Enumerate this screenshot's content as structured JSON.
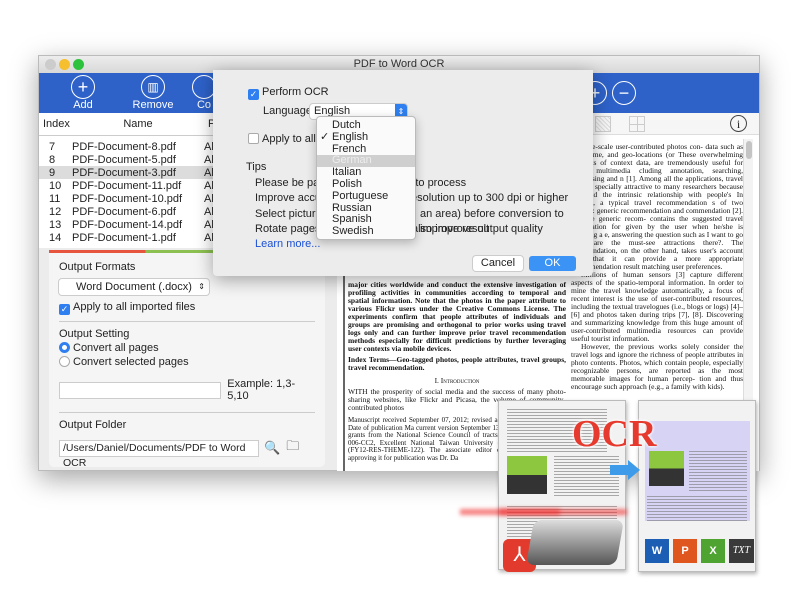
{
  "window": {
    "title": "PDF to Word OCR"
  },
  "toolbar": {
    "add": "Add",
    "remove": "Remove",
    "convert": "Co"
  },
  "list": {
    "headers": [
      "Index",
      "Name",
      "Pa"
    ],
    "rows": [
      {
        "index": "7",
        "name": "PDF-Document-8.pdf",
        "pages": "All"
      },
      {
        "index": "8",
        "name": "PDF-Document-5.pdf",
        "pages": "All"
      },
      {
        "index": "9",
        "name": "PDF-Document-3.pdf",
        "pages": "All"
      },
      {
        "index": "10",
        "name": "PDF-Document-11.pdf",
        "pages": "All"
      },
      {
        "index": "11",
        "name": "PDF-Document-10.pdf",
        "pages": "All"
      },
      {
        "index": "12",
        "name": "PDF-Document-6.pdf",
        "pages": "All"
      },
      {
        "index": "13",
        "name": "PDF-Document-14.pdf",
        "pages": "All"
      },
      {
        "index": "14",
        "name": "PDF-Document-1.pdf",
        "pages": "All"
      }
    ],
    "selected_index": "9"
  },
  "output": {
    "formats_label": "Output Formats",
    "format_value": "Word Document (.docx)",
    "apply_all": "Apply to all imported files",
    "setting_label": "Output Setting",
    "convert_all": "Convert all pages",
    "convert_selected": "Convert selected pages",
    "pages_input": "",
    "example": "Example: 1,3-5,10",
    "folder_label": "Output Folder",
    "folder_path": "/Users/Daniel/Documents/PDF to Word OCR"
  },
  "dialog": {
    "perform_ocr": "Perform OCR",
    "language_label": "Language:",
    "language_value": "English",
    "apply_all": "Apply to all imp",
    "tips_title": "Tips",
    "tips": [
      "Please be patient",
      "me to process",
      "Improve accurac",
      "esolution up to 300 dpi or higher",
      "Select picture are",
      "an area) before conversion to improve result",
      "Rotate pages to",
      "also improve output quality"
    ],
    "learn_more": "Learn more...",
    "cancel": "Cancel",
    "ok": "OK",
    "languages": [
      "Dutch",
      "English",
      "French",
      "German",
      "Italian",
      "Polish",
      "Portuguese",
      "Russian",
      "Spanish",
      "Swedish"
    ],
    "checked_language": "English",
    "highlighted_language": "German"
  },
  "document": {
    "colA": [
      "major cities worldwide and conduct the extensive investigation of profiling activities in communities according to temporal and spatial information. Note that the photos in the paper attribute to various Flickr users under the Creative Commons License. The experiments confirm that people attributes of individuals and groups are promising and orthogonal to prior works using travel logs only and can further improve prior travel recommendation methods especially for difficult predictions by further leveraging user contexts via mobile devices.",
      "Index Terms—Geo-tagged photos, people attributes, travel groups, travel recommendation.",
      "I. Introduction",
      "WITH the prosperity of social media and the success of many photo-sharing websites, like Flickr and Picasa, the volume of community-contributed photos",
      "Manuscript received September 07, 2012; revised accepted April 04, 2013. Date of publication Ma current version September 13, 2013. This work w by grants from the National Science Council of tracts NSC 101-2622-E-002-006-CC2, Excellent National Taiwan University (AE00-00-05), and Mi (FY12-RES-THEME-122). The associate editor coordi manuscript and approving it for publication was Dr. Da"
    ],
    "colB": [
      "ch large-scale user-contributed photos con- data such as tags, time, and geo-locations (or These overwhelming amounts of context data, are tremendously useful for many multimedia cluding annotation, searching, advertising and n [1]. Among all the applications, travel recom- specially attractive to many researchers because ace and the intrinsic relationship with people's In general, a typical travel recommendation s of two aspects: generic recommendation and commendation [2]. For the generic recom- contains the suggested travel information for given by the user when he/she is planning a e, answering the question such as I want to go what are the must-see attractions there?. The commendation, on the other hand, takes user's account such that it can provide a more appropriate recommendation result matching user preferences.",
      "Millions of human sensors [3] capture different aspects of the spatio-temporal information. In order to mine the travel knowledge automatically, a focus of recent interest is the use of user-contributed resources, including the textual travelogues (i.e., blogs or logs) [4]–[6] and photos taken during trips [7], [8]. Discovering and summarizing knowledge from this huge amount of user-contributed multimedia resources can provide useful tourist information.",
      "However, the previous works solely consider the travel logs and ignore the richness of people attributes in photo contents. Photos, which contain people, especially recognizable persons, are reported as the most memorable images for human percep- tion and thus encourage such approach (e.g., a family with kids)."
    ]
  },
  "badge": {
    "ocr_text": "OCR",
    "txt_label": "TXT"
  },
  "colors": {
    "toolbar": "#2e62c9",
    "accent": "#2f7ff0",
    "ocr_red": "#e63a2e"
  }
}
